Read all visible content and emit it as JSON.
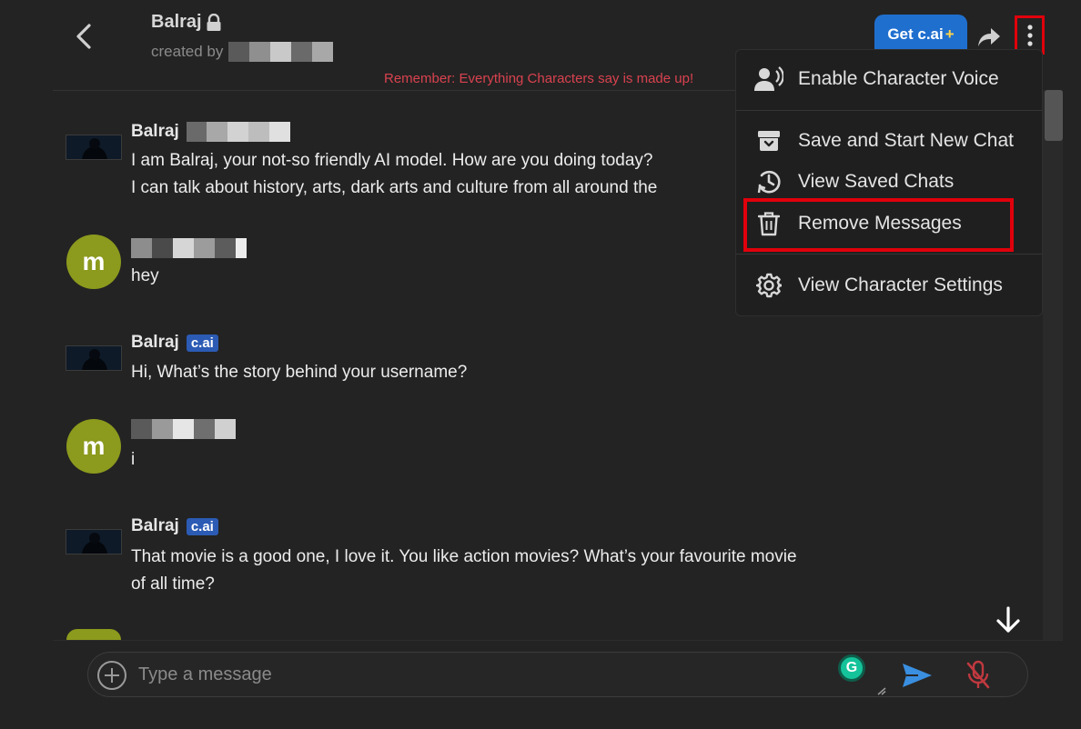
{
  "header": {
    "character_name": "Balraj",
    "created_by_label": "created by",
    "get_cai_label": "Get c.ai",
    "get_cai_plus": "+",
    "disclaimer": "Remember: Everything Characters say is made up!"
  },
  "messages": [
    {
      "author": "Balraj",
      "lines": [
        "I am Balraj, your not-so friendly AI model. How are you doing today?",
        "I can talk about history, arts, dark arts and culture from all around the"
      ]
    },
    {
      "avatar_letter": "m",
      "lines": [
        "hey"
      ]
    },
    {
      "author": "Balraj",
      "badge": "c.ai",
      "lines": [
        "Hi, What’s the story behind your username?"
      ]
    },
    {
      "avatar_letter": "m",
      "lines": [
        "i"
      ]
    },
    {
      "author": "Balraj",
      "badge": "c.ai",
      "lines": [
        "That movie is a good one, I love it. You like action movies? What’s your favourite movie",
        "of all time?"
      ]
    }
  ],
  "menu": {
    "items": [
      {
        "label": "Enable Character Voice",
        "icon": "voice-icon"
      },
      {
        "label": "Save and Start New Chat",
        "icon": "archive-icon"
      },
      {
        "label": "View Saved Chats",
        "icon": "history-icon"
      },
      {
        "label": "Remove Messages",
        "icon": "trash-icon"
      },
      {
        "label": "View Character Settings",
        "icon": "gear-icon"
      }
    ]
  },
  "composer": {
    "placeholder": "Type a message",
    "grammarly_letter": "G"
  },
  "colors": {
    "background": "#232323",
    "accent_blue": "#1f6fcf",
    "highlight_red": "#e0000b",
    "disclaimer_red": "#d9424f",
    "user_avatar": "#8c9a1d"
  }
}
